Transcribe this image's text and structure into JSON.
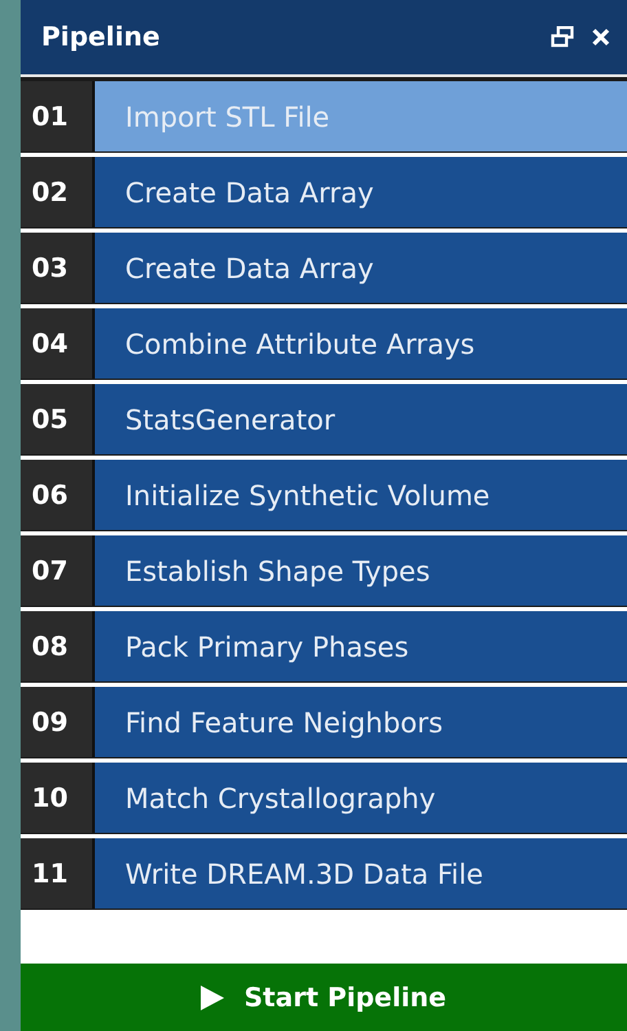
{
  "panel": {
    "title": "Pipeline"
  },
  "filters": [
    {
      "number": "01",
      "name": "Import STL File",
      "selected": true
    },
    {
      "number": "02",
      "name": "Create Data Array",
      "selected": false
    },
    {
      "number": "03",
      "name": "Create Data Array",
      "selected": false
    },
    {
      "number": "04",
      "name": "Combine Attribute Arrays",
      "selected": false
    },
    {
      "number": "05",
      "name": "StatsGenerator",
      "selected": false
    },
    {
      "number": "06",
      "name": "Initialize Synthetic Volume",
      "selected": false
    },
    {
      "number": "07",
      "name": "Establish Shape Types",
      "selected": false
    },
    {
      "number": "08",
      "name": "Pack Primary Phases",
      "selected": false
    },
    {
      "number": "09",
      "name": "Find Feature Neighbors",
      "selected": false
    },
    {
      "number": "10",
      "name": "Match Crystallography",
      "selected": false
    },
    {
      "number": "11",
      "name": "Write DREAM.3D Data File",
      "selected": false
    }
  ],
  "start_button": {
    "label": "Start Pipeline"
  }
}
